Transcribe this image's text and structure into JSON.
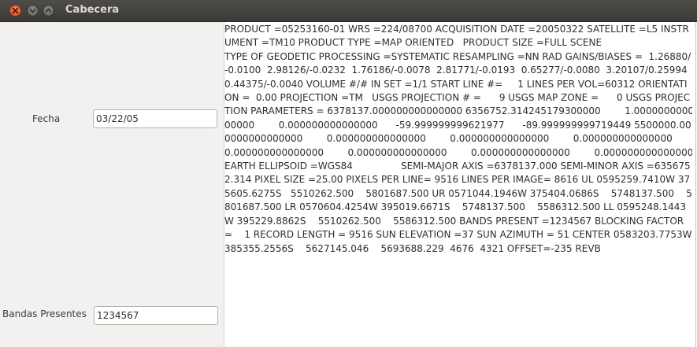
{
  "window": {
    "title": "Cabecera"
  },
  "form": {
    "fecha_label": "Fecha",
    "fecha_value": "03/22/05",
    "bandas_label": "Bandas Presentes",
    "bandas_value": "1234567"
  },
  "header_text": "PRODUCT =05253160-01 WRS =224/08700 ACQUISITION DATE =20050322 SATELLITE =L5 INSTRUMENT =TM10 PRODUCT TYPE =MAP ORIENTED   PRODUCT SIZE =FULL SCENE                                                                   TYPE OF GEODETIC PROCESSING =SYSTEMATIC RESAMPLING =NN RAD GAINS/BIASES =  1.26880/-0.0100  2.98126/-0.0232  1.76186/-0.0078  2.81771/-0.0193  0.65277/-0.0080  3.20107/0.25994  0.44375/-0.0040 VOLUME #/# IN SET =1/1 START LINE #=     1 LINES PER VOL=60312 ORIENTATION =  0.00 PROJECTION =TM   USGS PROJECTION # =      9 USGS MAP ZONE =      0 USGS PROJECTION PARAMETERS = 6378137.000000000000000 6356752.314245179300000        1.000000000000000        0.000000000000000      -59.999999999621977      -89.999999999719449 5500000.000000000000000        0.000000000000000        0.000000000000000        0.000000000000000        0.000000000000000        0.000000000000000        0.000000000000000        0.000000000000000 EARTH ELLIPSOID =WGS84                SEMI-MAJOR AXIS =6378137.000 SEMI-MINOR AXIS =6356752.314 PIXEL SIZE =25.00 PIXELS PER LINE= 9516 LINES PER IMAGE= 8616 UL 0595259.7410W 375605.6275S   5510262.500    5801687.500 UR 0571044.1946W 375404.0686S    5748137.500    5801687.500 LR 0570604.4254W 395019.6671S    5748137.500    5586312.500 LL 0595248.1443W 395229.8862S    5510262.500    5586312.500 BANDS PRESENT =1234567 BLOCKING FACTOR =    1 RECORD LENGTH = 9516 SUN ELEVATION =37 SUN AZIMUTH = 51 CENTER 0583203.7753W 385355.2556S    5627145.046    5693688.229  4676  4321 OFFSET=-235 REVB",
  "icons": {
    "close": "close-icon",
    "minimize": "minimize-icon",
    "maximize": "maximize-icon"
  },
  "colors": {
    "titlebar": "#3c3b37",
    "close_button": "#e25a2b",
    "window_background": "#f2f1f0"
  }
}
